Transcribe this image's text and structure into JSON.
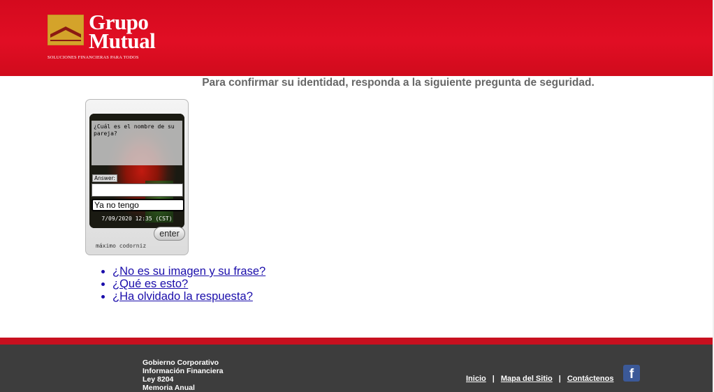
{
  "header": {
    "logo_line1": "Grupo",
    "logo_line2": "Mutual",
    "logo_tagline": "SOLUCIONES FINANCIERAS PARA TODOS",
    "brand_color": "#d40a1e",
    "logo_icon": "house-roof-logo"
  },
  "main": {
    "prompt": "Para confirmar su identidad, responda a la siguiente pregunta de seguridad."
  },
  "security_widget": {
    "question": "¿Cuál es el nombre de su pareja?",
    "answer_label": "Answer:",
    "answer_value": "Ya no tengo",
    "date": "7/09/2020 12:35 (CST)",
    "enter_label": "enter",
    "caption": "máximo codorniz"
  },
  "links": [
    "¿No es su imagen y su frase?",
    "¿Qué es esto?",
    "¿Ha olvidado la respuesta?"
  ],
  "footer": {
    "left_links": [
      "Gobierno Corporativo",
      "Información Financiera",
      "Ley 8204",
      "Memoria Anual"
    ],
    "nav": [
      "Inicio",
      "Mapa del Sitio",
      "Contáctenos"
    ],
    "nav_separator": "|",
    "social_icon": "facebook-icon",
    "social_glyph": "f"
  }
}
